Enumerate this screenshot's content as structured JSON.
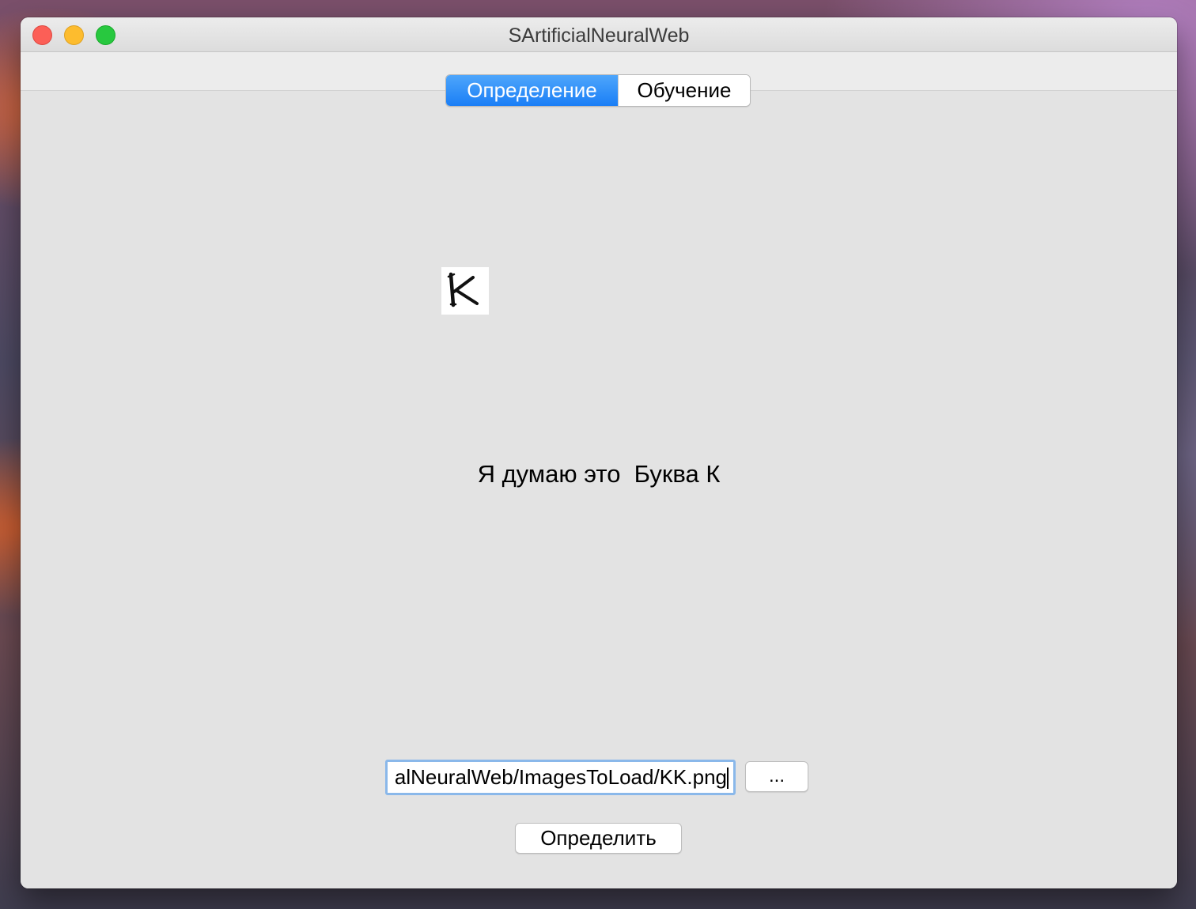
{
  "window": {
    "title": "SArtificialNeuralWeb"
  },
  "tabs": [
    {
      "label": "Определение",
      "active": true
    },
    {
      "label": "Обучение",
      "active": false
    }
  ],
  "preview": {
    "icon": "letter-k-image",
    "glyph": "K"
  },
  "result": {
    "text": "Я думаю это  Буква К"
  },
  "file": {
    "path_value": "alNeuralWeb/ImagesToLoad/KK.png",
    "browse_label": "..."
  },
  "actions": {
    "detect_label": "Определить"
  },
  "colors": {
    "accent": "#1a7ef6",
    "focus_ring": "#8ab8ea",
    "close": "#fc5f57",
    "minimize": "#fdbc2e",
    "zoom": "#28c83f"
  }
}
